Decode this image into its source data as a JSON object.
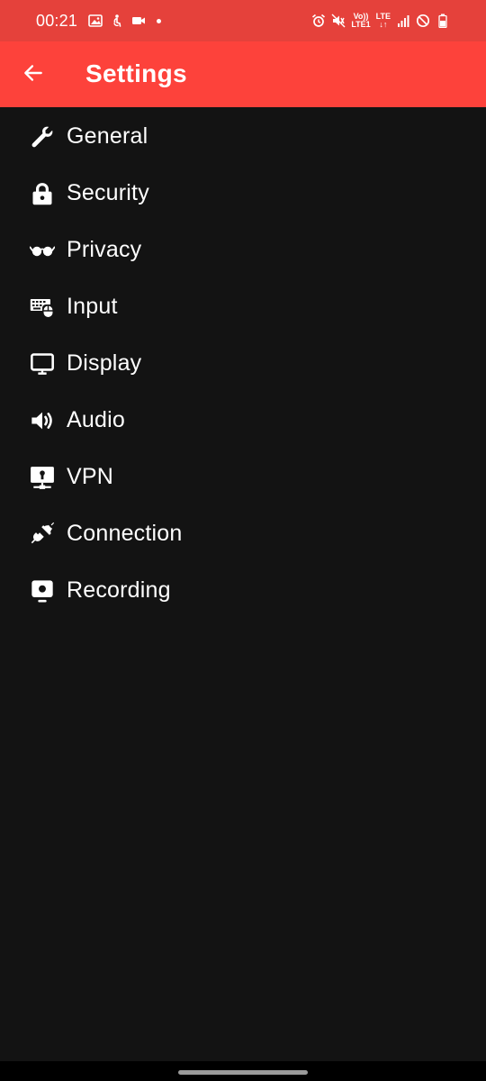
{
  "status_bar": {
    "time": "00:21",
    "left_icons": [
      "gallery-icon",
      "accessibility-icon",
      "video-camera-icon",
      "dot-icon"
    ],
    "right_icons": [
      "alarm-icon",
      "mute-icon",
      "volte-icon",
      "lte-icon",
      "signal-icon",
      "do-not-disturb-icon",
      "battery-icon"
    ],
    "volte_label_top": "Vo))",
    "volte_label_bottom": "LTE1",
    "lte_label": "LTE"
  },
  "app_bar": {
    "title": "Settings",
    "back_icon": "arrow-left-icon",
    "background": "#fd423b"
  },
  "menu": {
    "items": [
      {
        "label": "General",
        "icon": "wrench-icon"
      },
      {
        "label": "Security",
        "icon": "lock-icon"
      },
      {
        "label": "Privacy",
        "icon": "glasses-icon"
      },
      {
        "label": "Input",
        "icon": "keyboard-mouse-icon"
      },
      {
        "label": "Display",
        "icon": "monitor-icon"
      },
      {
        "label": "Audio",
        "icon": "speaker-icon"
      },
      {
        "label": "VPN",
        "icon": "vpn-icon"
      },
      {
        "label": "Connection",
        "icon": "plug-icon"
      },
      {
        "label": "Recording",
        "icon": "recording-icon"
      }
    ]
  },
  "colors": {
    "status_bar": "#e5413b",
    "app_bar": "#fd423b",
    "background": "#131313",
    "text": "#ffffff"
  }
}
